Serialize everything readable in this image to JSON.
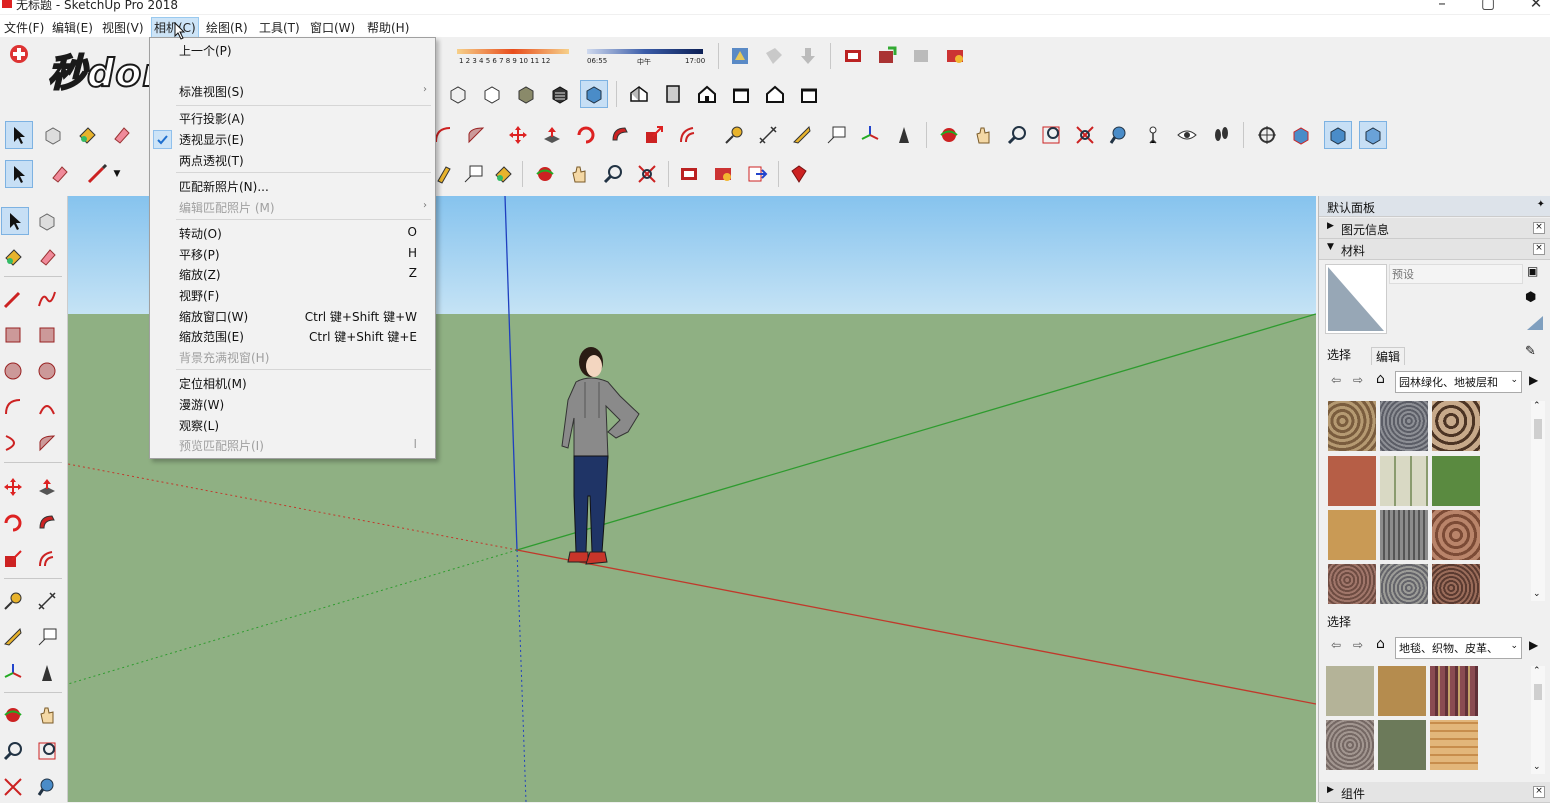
{
  "window": {
    "title": "无标题 - SketchUp Pro 2018"
  },
  "menubar": {
    "items": [
      "文件(F)",
      "编辑(E)",
      "视图(V)",
      "相机(C)",
      "绘图(R)",
      "工具(T)",
      "窗口(W)",
      "帮助(H)"
    ],
    "active": "相机(C)"
  },
  "shadow_bar": {
    "months": "1 2 3 4 5 6 7 8 9 10 11 12",
    "time_start": "06:55",
    "time_mid": "中午",
    "time_end": "17:00"
  },
  "logo": {
    "text": "秒dong视频"
  },
  "camera_menu": {
    "items": [
      {
        "label": "上一个(P)",
        "shortcut": "",
        "disabled": false
      },
      {
        "label": "标准视图(S)",
        "shortcut": "",
        "disabled": false,
        "submenu": true
      },
      {
        "label": "平行投影(A)",
        "shortcut": "",
        "disabled": false
      },
      {
        "label": "透视显示(E)",
        "shortcut": "",
        "disabled": false,
        "checked": true
      },
      {
        "label": "两点透视(T)",
        "shortcut": "",
        "disabled": false
      },
      {
        "label": "匹配新照片(N)...",
        "shortcut": "",
        "disabled": false
      },
      {
        "label": "编辑匹配照片 (M)",
        "shortcut": "",
        "disabled": true,
        "submenu": true
      },
      {
        "label": "转动(O)",
        "shortcut": "O",
        "disabled": false
      },
      {
        "label": "平移(P)",
        "shortcut": "H",
        "disabled": false
      },
      {
        "label": "缩放(Z)",
        "shortcut": "Z",
        "disabled": false
      },
      {
        "label": "视野(F)",
        "shortcut": "",
        "disabled": false
      },
      {
        "label": "缩放窗口(W)",
        "shortcut": "Ctrl 键+Shift 键+W",
        "disabled": false
      },
      {
        "label": "缩放范围(E)",
        "shortcut": "Ctrl 键+Shift 键+E",
        "disabled": false
      },
      {
        "label": "背景充满视窗(H)",
        "shortcut": "",
        "disabled": true
      },
      {
        "label": "定位相机(M)",
        "shortcut": "",
        "disabled": false
      },
      {
        "label": "漫游(W)",
        "shortcut": "",
        "disabled": false
      },
      {
        "label": "观察(L)",
        "shortcut": "",
        "disabled": false
      },
      {
        "label": "预览匹配照片(I)",
        "shortcut": "I",
        "disabled": true
      }
    ]
  },
  "tray": {
    "title": "默认面板",
    "entity_info": "图元信息",
    "materials": "材料",
    "preset_placeholder": "预设",
    "tab_select": "选择",
    "tab_edit": "编辑",
    "library_1": "园林绿化、地被层和",
    "select2": "选择",
    "library_2": "地毯、织物、皮革、",
    "components": "组件"
  },
  "colors": {
    "ground": "#8fb083",
    "sky": "#9ed0f1",
    "axis_red": "#c0392b",
    "axis_green": "#2e9b2e",
    "axis_blue": "#1f3fbf",
    "menu_highlight": "#cde4f7"
  }
}
